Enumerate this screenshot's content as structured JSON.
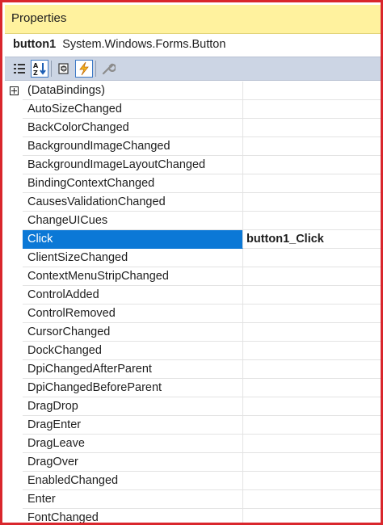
{
  "window": {
    "title": "Properties",
    "object_name": "button1",
    "object_type": "System.Windows.Forms.Button"
  },
  "toolbar": {
    "buttons": [
      {
        "icon": "categorized-icon",
        "active": false
      },
      {
        "icon": "alphabetical-icon",
        "active": true
      },
      {
        "icon": "properties-icon",
        "active": false
      },
      {
        "icon": "events-lightning-icon",
        "active": true
      },
      {
        "icon": "property-pages-wrench-icon",
        "active": false
      }
    ]
  },
  "events": [
    {
      "name": "(DataBindings)",
      "value": "",
      "expandable": true
    },
    {
      "name": "AutoSizeChanged",
      "value": ""
    },
    {
      "name": "BackColorChanged",
      "value": ""
    },
    {
      "name": "BackgroundImageChanged",
      "value": ""
    },
    {
      "name": "BackgroundImageLayoutChanged",
      "value": ""
    },
    {
      "name": "BindingContextChanged",
      "value": ""
    },
    {
      "name": "CausesValidationChanged",
      "value": ""
    },
    {
      "name": "ChangeUICues",
      "value": ""
    },
    {
      "name": "Click",
      "value": "button1_Click",
      "selected": true
    },
    {
      "name": "ClientSizeChanged",
      "value": ""
    },
    {
      "name": "ContextMenuStripChanged",
      "value": ""
    },
    {
      "name": "ControlAdded",
      "value": ""
    },
    {
      "name": "ControlRemoved",
      "value": ""
    },
    {
      "name": "CursorChanged",
      "value": ""
    },
    {
      "name": "DockChanged",
      "value": ""
    },
    {
      "name": "DpiChangedAfterParent",
      "value": ""
    },
    {
      "name": "DpiChangedBeforeParent",
      "value": ""
    },
    {
      "name": "DragDrop",
      "value": ""
    },
    {
      "name": "DragEnter",
      "value": ""
    },
    {
      "name": "DragLeave",
      "value": ""
    },
    {
      "name": "DragOver",
      "value": ""
    },
    {
      "name": "EnabledChanged",
      "value": ""
    },
    {
      "name": "Enter",
      "value": ""
    },
    {
      "name": "FontChanged",
      "value": ""
    }
  ],
  "colors": {
    "title_bar": "#fff29e",
    "selection": "#0b78d6",
    "toolbar": "#ccd5e4",
    "frame_border": "#d9262c"
  }
}
